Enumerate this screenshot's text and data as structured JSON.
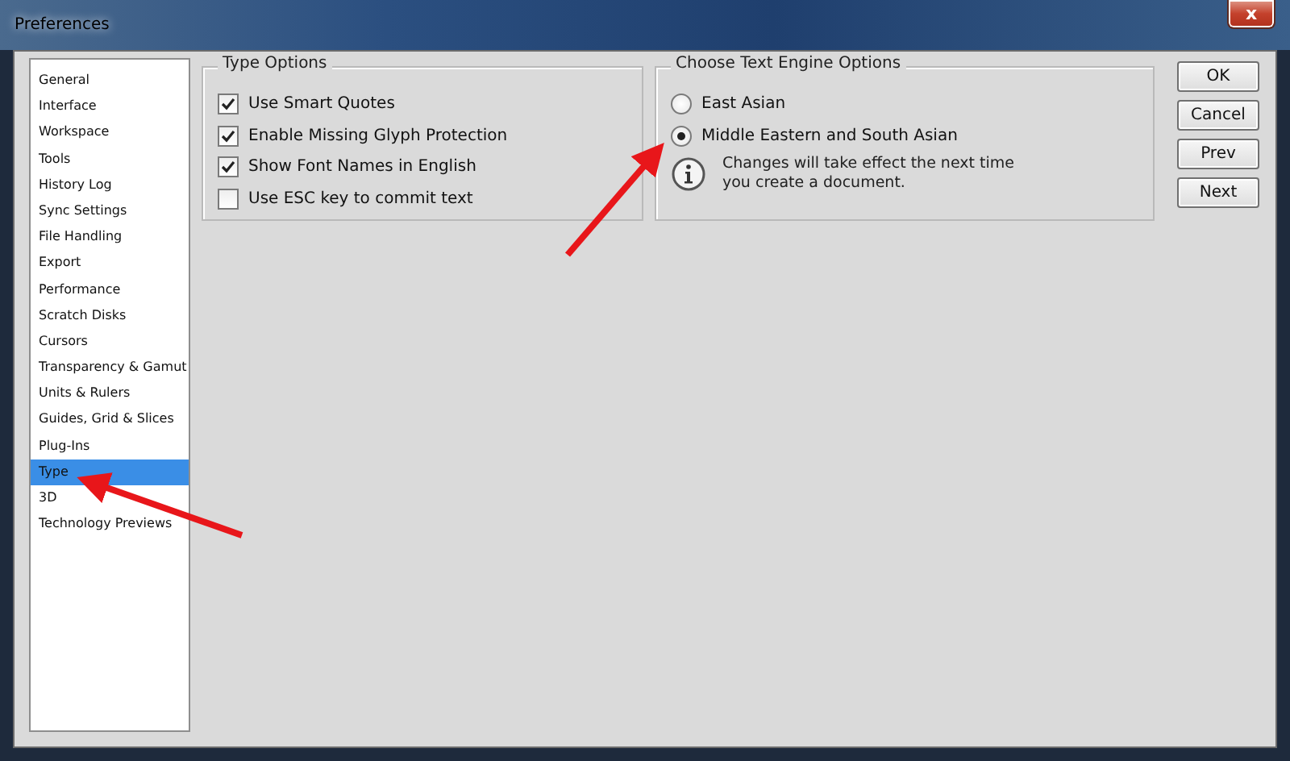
{
  "window": {
    "title": "Preferences",
    "close_icon": "x"
  },
  "sidebar": {
    "items": [
      {
        "label": "General",
        "selected": false
      },
      {
        "label": "Interface",
        "selected": false
      },
      {
        "label": "Workspace",
        "selected": false
      },
      {
        "label": "Tools",
        "selected": false
      },
      {
        "label": "History Log",
        "selected": false
      },
      {
        "label": "Sync Settings",
        "selected": false
      },
      {
        "label": "File Handling",
        "selected": false
      },
      {
        "label": "Export",
        "selected": false
      },
      {
        "label": "Performance",
        "selected": false
      },
      {
        "label": "Scratch Disks",
        "selected": false
      },
      {
        "label": "Cursors",
        "selected": false
      },
      {
        "label": "Transparency & Gamut",
        "selected": false
      },
      {
        "label": "Units & Rulers",
        "selected": false
      },
      {
        "label": "Guides, Grid & Slices",
        "selected": false
      },
      {
        "label": "Plug-Ins",
        "selected": false
      },
      {
        "label": "Type",
        "selected": true
      },
      {
        "label": "3D",
        "selected": false
      },
      {
        "label": "Technology Previews",
        "selected": false
      }
    ]
  },
  "type_options": {
    "title": "Type Options",
    "checkboxes": [
      {
        "label": "Use Smart Quotes",
        "checked": true
      },
      {
        "label": "Enable Missing Glyph Protection",
        "checked": true
      },
      {
        "label": "Show Font Names in English",
        "checked": true
      },
      {
        "label": "Use ESC key to commit text",
        "checked": false
      }
    ]
  },
  "text_engine": {
    "title": "Choose Text Engine Options",
    "radios": [
      {
        "label": "East Asian",
        "selected": false
      },
      {
        "label": "Middle Eastern and South Asian",
        "selected": true
      }
    ],
    "note": "Changes will take effect the next time you create a document."
  },
  "buttons": [
    "OK",
    "Cancel",
    "Prev",
    "Next"
  ]
}
